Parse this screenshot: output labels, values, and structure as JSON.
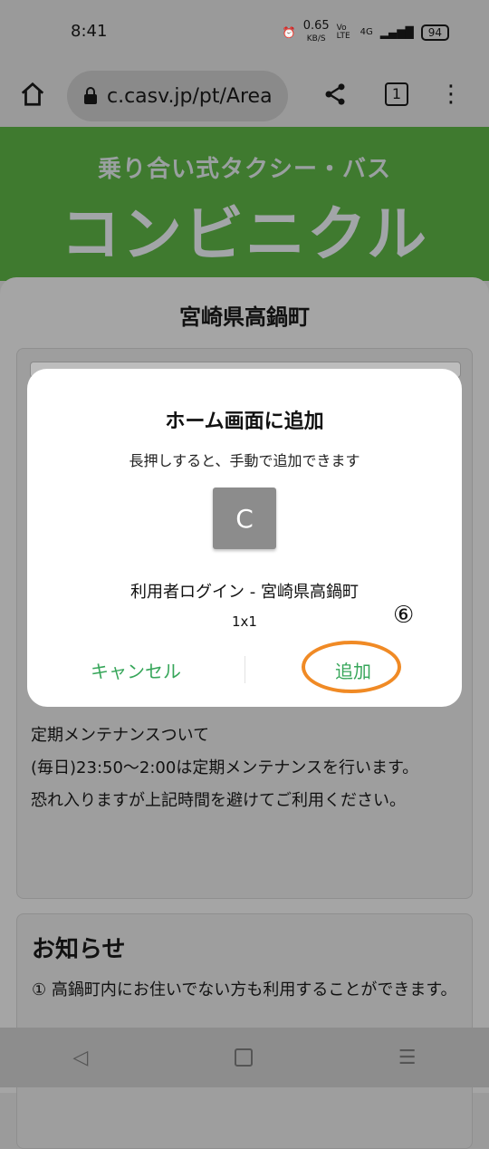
{
  "status": {
    "time": "8:41",
    "net_speed": "0.65",
    "net_unit": "KB/S",
    "volte": "Vo LTE",
    "signal": "4G",
    "battery": "94"
  },
  "browser": {
    "url": "c.casv.jp/pt/Area",
    "tab_count": "1"
  },
  "banner": {
    "subtitle": "乗り合い式タクシー・バス",
    "title": "コンビニクル"
  },
  "page": {
    "prefecture": "宮崎県高鍋町"
  },
  "maintenance": {
    "text": "定期メンテナンスついて\n(毎日)23:50〜2:00は定期メンテナンスを行います。\n恐れ入りますが上記時間を避けてご利用ください。"
  },
  "news": {
    "heading": "お知らせ",
    "body": "① 高鍋町内にお住いでない方も利用することができます。"
  },
  "dialog": {
    "title": "ホーム画面に追加",
    "description": "長押しすると、手動で追加できます",
    "icon_letter": "C",
    "app_name": "利用者ログイン - 宮崎県高鍋町",
    "size": "1x1",
    "annotation": "⑥",
    "cancel_label": "キャンセル",
    "add_label": "追加"
  },
  "colors": {
    "accent": "#37a65a",
    "highlight": "#f08a25",
    "banner": "#3f7a2f"
  }
}
